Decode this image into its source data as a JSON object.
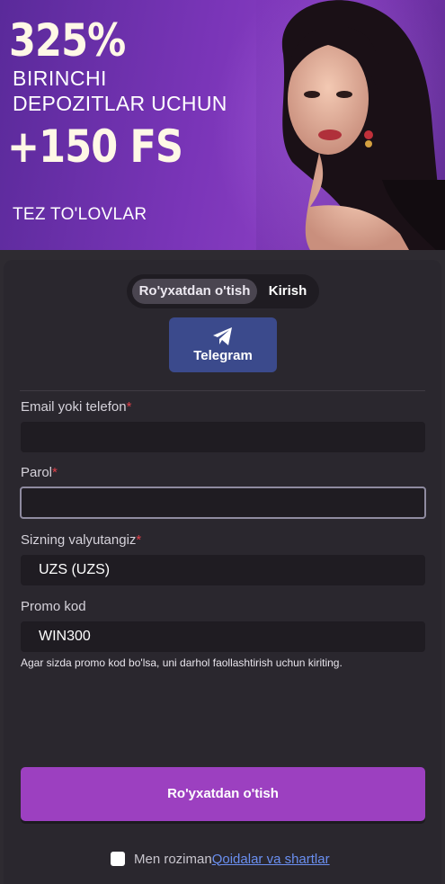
{
  "banner": {
    "bonus_percent": "325%",
    "line1": "BIRINCHI",
    "line2": "DEPOZITLAR UCHUN",
    "free_spins": "+150 FS",
    "payments": "TEZ TO'LOVLAR"
  },
  "tabs": [
    {
      "label": "Ro'yxatdan o'tish",
      "active": true
    },
    {
      "label": "Kirish",
      "active": false
    }
  ],
  "telegram": {
    "label": "Telegram",
    "icon": "telegram-plane-icon"
  },
  "form": {
    "email": {
      "label": "Email yoki telefon",
      "required": "*",
      "value": ""
    },
    "password": {
      "label": "Parol",
      "required": "*",
      "value": ""
    },
    "currency": {
      "label": "Sizning valyutangiz",
      "required": "*",
      "value": "UZS (UZS)"
    },
    "promo": {
      "label": "Promo kod",
      "value": "WIN300",
      "hint": "Agar sizda promo kod bo'lsa, uni darhol faollashtirish uchun kiriting."
    }
  },
  "submit_label": "Ro'yxatdan o'tish",
  "agree": {
    "text": "Men roziman",
    "link": "Qoidalar va shartlar"
  },
  "colors": {
    "accent": "#9c40c0",
    "telegram": "#3b4a8c",
    "link": "#6a8ff0",
    "required": "#e0404a"
  }
}
